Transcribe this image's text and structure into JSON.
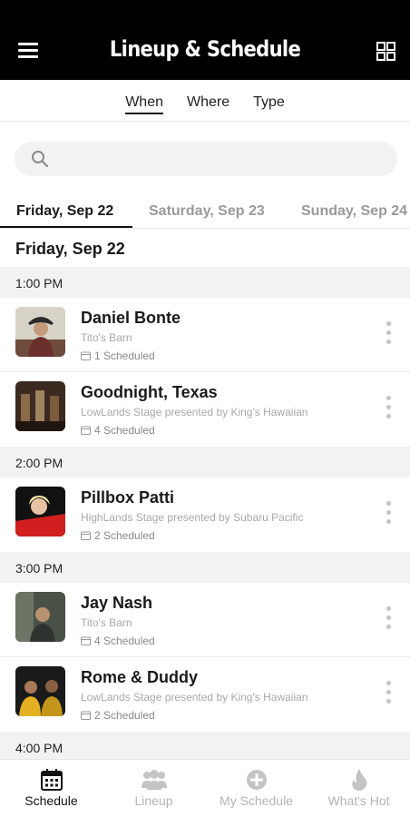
{
  "header": {
    "title": "Lineup & Schedule",
    "menu_icon": "hamburger-menu-icon",
    "layout_icon": "grid-view-icon"
  },
  "filter_tabs": [
    {
      "label": "When",
      "active": true
    },
    {
      "label": "Where",
      "active": false
    },
    {
      "label": "Type",
      "active": false
    }
  ],
  "search": {
    "placeholder": "",
    "value": "",
    "icon": "search-icon"
  },
  "day_tabs": [
    {
      "label": "Friday, Sep 22",
      "active": true
    },
    {
      "label": "Saturday, Sep 23",
      "active": false
    },
    {
      "label": "Sunday, Sep 24",
      "active": false
    }
  ],
  "date_heading": "Friday, Sep 22",
  "time_groups": [
    {
      "time": "1:00 PM",
      "items": [
        {
          "artist": "Daniel Bonte",
          "venue": "Tito's Barn",
          "scheduled": "1 Scheduled"
        },
        {
          "artist": "Goodnight, Texas",
          "venue": "LowLands Stage presented by King's Hawaiian",
          "scheduled": "4 Scheduled"
        }
      ]
    },
    {
      "time": "2:00 PM",
      "items": [
        {
          "artist": "Pillbox Patti",
          "venue": "HighLands Stage presented by Subaru Pacific",
          "scheduled": "2 Scheduled"
        }
      ]
    },
    {
      "time": "3:00 PM",
      "items": [
        {
          "artist": "Jay Nash",
          "venue": "Tito's Barn",
          "scheduled": "4 Scheduled"
        },
        {
          "artist": "Rome & Duddy",
          "venue": "LowLands Stage presented by King's Hawaiian",
          "scheduled": "2 Scheduled"
        }
      ]
    },
    {
      "time": "4:00 PM",
      "items": []
    }
  ],
  "bottom_nav": [
    {
      "label": "Schedule",
      "icon": "calendar-icon",
      "active": true
    },
    {
      "label": "Lineup",
      "icon": "people-group-icon",
      "active": false
    },
    {
      "label": "My Schedule",
      "icon": "plus-circle-icon",
      "active": false
    },
    {
      "label": "What's Hot",
      "icon": "flame-icon",
      "active": false
    }
  ],
  "colors": {
    "header_bg": "#000000",
    "section_bg": "#f2f2f2",
    "inactive_text": "#b4b4b4",
    "active_text": "#111111"
  }
}
